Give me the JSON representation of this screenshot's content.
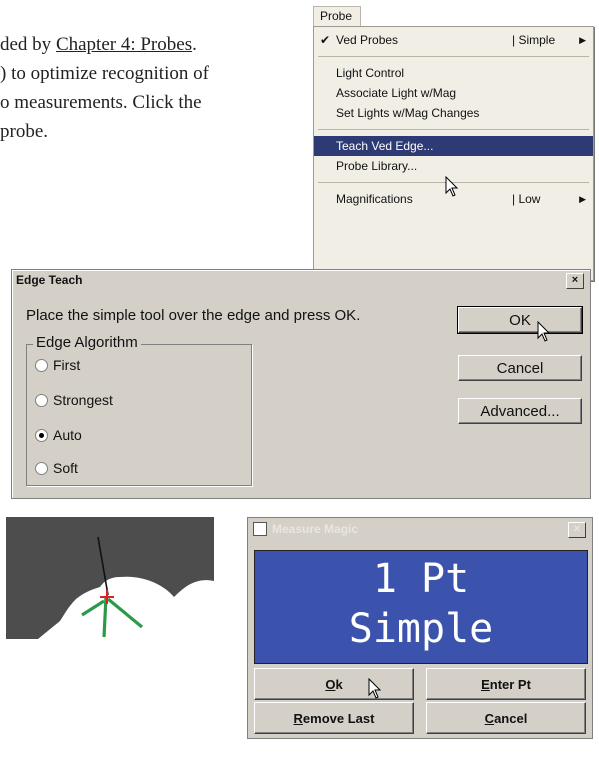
{
  "document": {
    "line1_pre": "ded by ",
    "line1_link": "Chapter 4:  Probes",
    "line1_post": ".",
    "line2": ") to optimize recognition of",
    "line3": "o measurements.  Click the",
    "line4": "probe."
  },
  "probe_menu": {
    "title": "Probe",
    "items": [
      {
        "label": "Ved Probes",
        "checked": true,
        "right": "| Simple"
      },
      {
        "label": "Light Control"
      },
      {
        "label": "Associate Light w/Mag"
      },
      {
        "label": "Set Lights w/Mag Changes"
      },
      {
        "label": "Teach Ved Edge...",
        "selected": true
      },
      {
        "label": "Probe Library..."
      },
      {
        "label": "Magnifications",
        "right": "| Low"
      }
    ]
  },
  "edge_teach": {
    "title": "Edge Teach",
    "close": "×",
    "instruction": "Place the simple tool over the edge and press OK.",
    "group_label": "Edge Algorithm",
    "options": [
      "First",
      "Strongest",
      "Auto",
      "Soft"
    ],
    "selected_option": "Auto",
    "buttons": {
      "ok": "OK",
      "cancel": "Cancel",
      "advanced": "Advanced..."
    }
  },
  "measure_magic": {
    "title": "Measure Magic",
    "close": "×",
    "display_line1": "1 Pt",
    "display_line2": "Simple",
    "buttons": {
      "ok_u": "O",
      "ok_rest": "k",
      "enter_u": "E",
      "enter_rest": "nter Pt",
      "remove_u": "R",
      "remove_rest": "emove Last",
      "cancel_u": "C",
      "cancel_rest": "ancel"
    }
  },
  "colors": {
    "menu_selected": "#2d3a73",
    "display_bg": "#3c53ad",
    "dialog_bg": "#d4d0c8"
  }
}
